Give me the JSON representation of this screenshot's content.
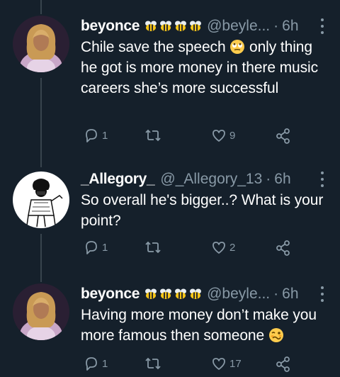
{
  "tweets": [
    {
      "display_name": "beyonce",
      "emoji_badges": [
        "bee",
        "bee",
        "bee",
        "bee"
      ],
      "handle": "@beyle...",
      "time": "6h",
      "text": "Chile save the speech",
      "text_emoji": "face-with-rolling-eyes",
      "text_after": " only thing he got is more money in there music careers she’s more successful",
      "reply_count": "1",
      "retweet_count": "",
      "like_count": "9"
    },
    {
      "display_name": "_Allegory_",
      "handle": "@_Allegory_13",
      "time": "6h",
      "text": "So overall he's bigger..? What is your point?",
      "reply_count": "1",
      "retweet_count": "",
      "like_count": "2"
    },
    {
      "display_name": "beyonce",
      "emoji_badges": [
        "bee",
        "bee",
        "bee",
        "bee"
      ],
      "handle": "@beyle...",
      "time": "6h",
      "text": "Having more money don’t make you more famous then someone",
      "text_emoji": "woozy-face",
      "reply_count": "1",
      "retweet_count": "",
      "like_count": "17"
    }
  ],
  "colors": {
    "background": "#15202b",
    "secondary_text": "#8899a6",
    "thread_line": "#38444d"
  }
}
